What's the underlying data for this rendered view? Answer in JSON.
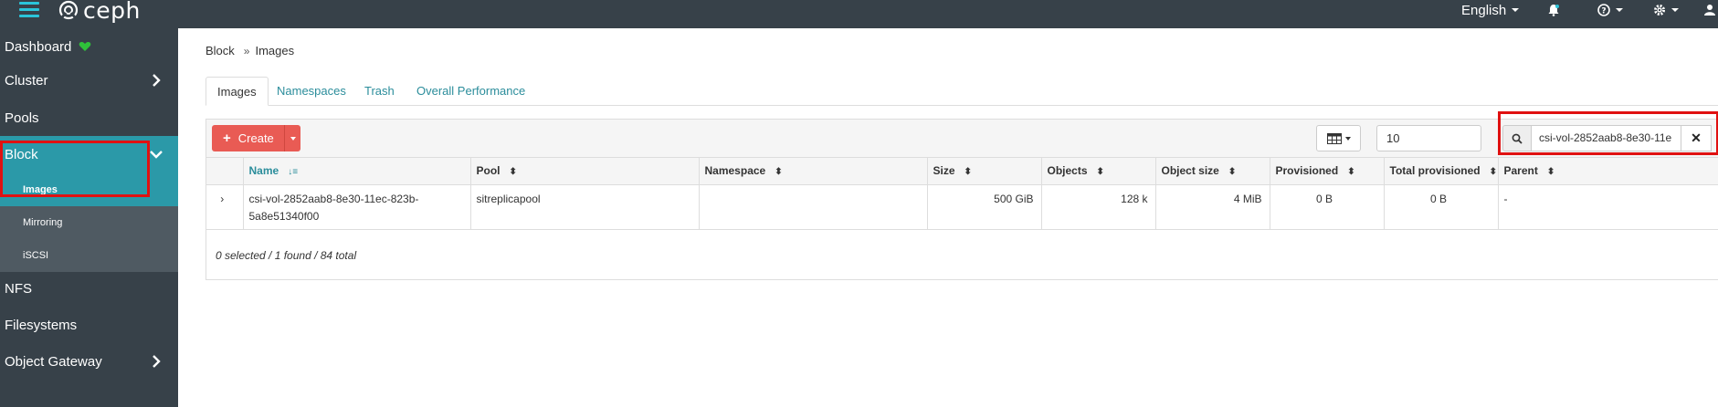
{
  "app": {
    "brand": "ceph",
    "accent": "#2b99a8",
    "danger": "#e95b54"
  },
  "topnav": {
    "language": "English"
  },
  "sidebar": {
    "items": [
      {
        "label": "Dashboard"
      },
      {
        "label": "Cluster"
      },
      {
        "label": "Pools"
      },
      {
        "label": "Block"
      },
      {
        "label": "NFS"
      },
      {
        "label": "Filesystems"
      },
      {
        "label": "Object Gateway"
      }
    ],
    "block_sub": [
      {
        "label": "Images"
      },
      {
        "label": "Mirroring"
      },
      {
        "label": "iSCSI"
      }
    ]
  },
  "breadcrumb": {
    "parent": "Block",
    "current": "Images"
  },
  "tabs": [
    "Images",
    "Namespaces",
    "Trash",
    "Overall Performance"
  ],
  "toolbar": {
    "create_label": "Create",
    "page_size": "10",
    "search_value": "csi-vol-2852aab8-8e30-11e"
  },
  "table": {
    "columns": [
      "Name",
      "Pool",
      "Namespace",
      "Size",
      "Objects",
      "Object size",
      "Provisioned",
      "Total provisioned",
      "Parent"
    ],
    "rows": [
      {
        "name": "csi-vol-2852aab8-8e30-11ec-823b-5a8e51340f00",
        "pool": "sitreplicapool",
        "namespace": "",
        "size": "500 GiB",
        "objects": "128 k",
        "object_size": "4 MiB",
        "provisioned": "0 B",
        "total_provisioned": "0 B",
        "parent": "-"
      }
    ],
    "footer": "0 selected / 1 found / 84 total"
  }
}
